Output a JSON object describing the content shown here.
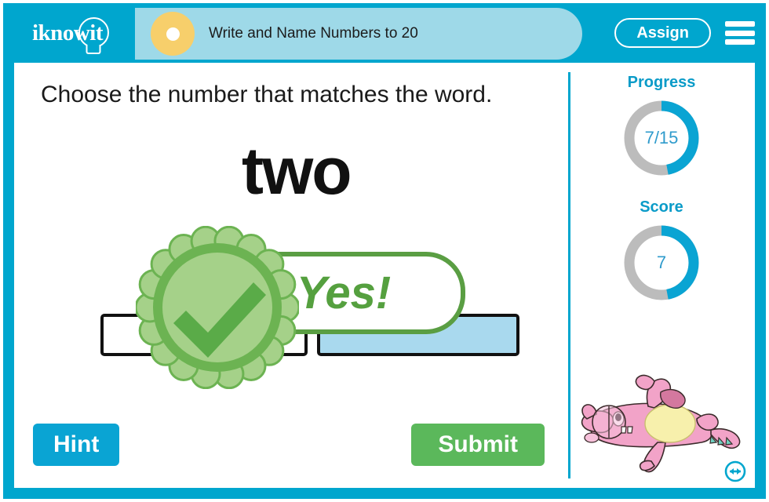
{
  "brand": {
    "logo_text": "iknowit",
    "logo_icon": "lightbulb-icon",
    "accent_teal": "#00a6ce",
    "accent_light_teal": "#9ed9e8",
    "accent_yellow": "#f7cf6b",
    "accent_green": "#5bb85b"
  },
  "header": {
    "lesson_title": "Write and Name Numbers to 20",
    "assign_label": "Assign",
    "menu_icon": "hamburger-menu-icon",
    "bullet_icon": "lesson-dot-icon"
  },
  "question": {
    "prompt": "Choose the number that matches the word.",
    "word": "two",
    "choices": [
      {
        "id": "a",
        "label": "",
        "selected": false
      },
      {
        "id": "b",
        "label": "",
        "selected": true
      }
    ]
  },
  "feedback": {
    "message": "Yes!",
    "badge_icon": "checkmark-rosette-icon",
    "correct": true,
    "border_color": "#5a9e43",
    "text_color": "#55a03f",
    "badge_fill": "#a5d189",
    "badge_ring": "#6cb352"
  },
  "actions": {
    "hint_label": "Hint",
    "submit_label": "Submit"
  },
  "sidebar": {
    "progress": {
      "label": "Progress",
      "value_text": "7/15",
      "current": 7,
      "total": 15,
      "percent": 47
    },
    "score": {
      "label": "Score",
      "value_text": "7",
      "current": 7,
      "percent": 47
    },
    "mascot_icon": "pink-dragon-mascot",
    "resize_icon": "resize-horizontal-icon"
  }
}
